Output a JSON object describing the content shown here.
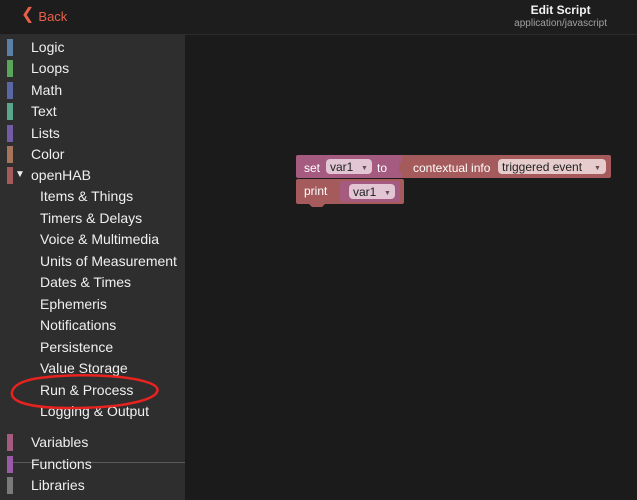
{
  "header": {
    "back_label": "Back",
    "title": "Edit Script",
    "subtitle": "application/javascript"
  },
  "sidebar": {
    "categories": [
      {
        "label": "Logic",
        "color": "#5b80a5"
      },
      {
        "label": "Loops",
        "color": "#5ba55b"
      },
      {
        "label": "Math",
        "color": "#5b67a5"
      },
      {
        "label": "Text",
        "color": "#5ba58c"
      },
      {
        "label": "Lists",
        "color": "#745ba5"
      },
      {
        "label": "Color",
        "color": "#a5745b"
      },
      {
        "label": "openHAB",
        "color": "#a55b5b",
        "expanded": true
      }
    ],
    "openhab_items": [
      "Items & Things",
      "Timers & Delays",
      "Voice & Multimedia",
      "Units of Measurement",
      "Dates & Times",
      "Ephemeris",
      "Notifications",
      "Persistence",
      "Value Storage",
      "Run & Process",
      "Logging & Output"
    ],
    "bottom_categories": [
      {
        "label": "Variables",
        "color": "#a55b80"
      },
      {
        "label": "Functions",
        "color": "#995ba5"
      },
      {
        "label": "Libraries",
        "color": "#7a7a7a"
      }
    ]
  },
  "blocks": {
    "set_keyword": "set",
    "set_var": "var1",
    "to_keyword": "to",
    "contextual_label": "contextual info",
    "contextual_value": "triggered event",
    "print_keyword": "print",
    "print_var": "var1",
    "variable_color": "#a55b80",
    "openhab_color": "#a55b5b"
  },
  "annotation": {
    "highlighted_item": "Run & Process",
    "color": "#e8231f"
  }
}
